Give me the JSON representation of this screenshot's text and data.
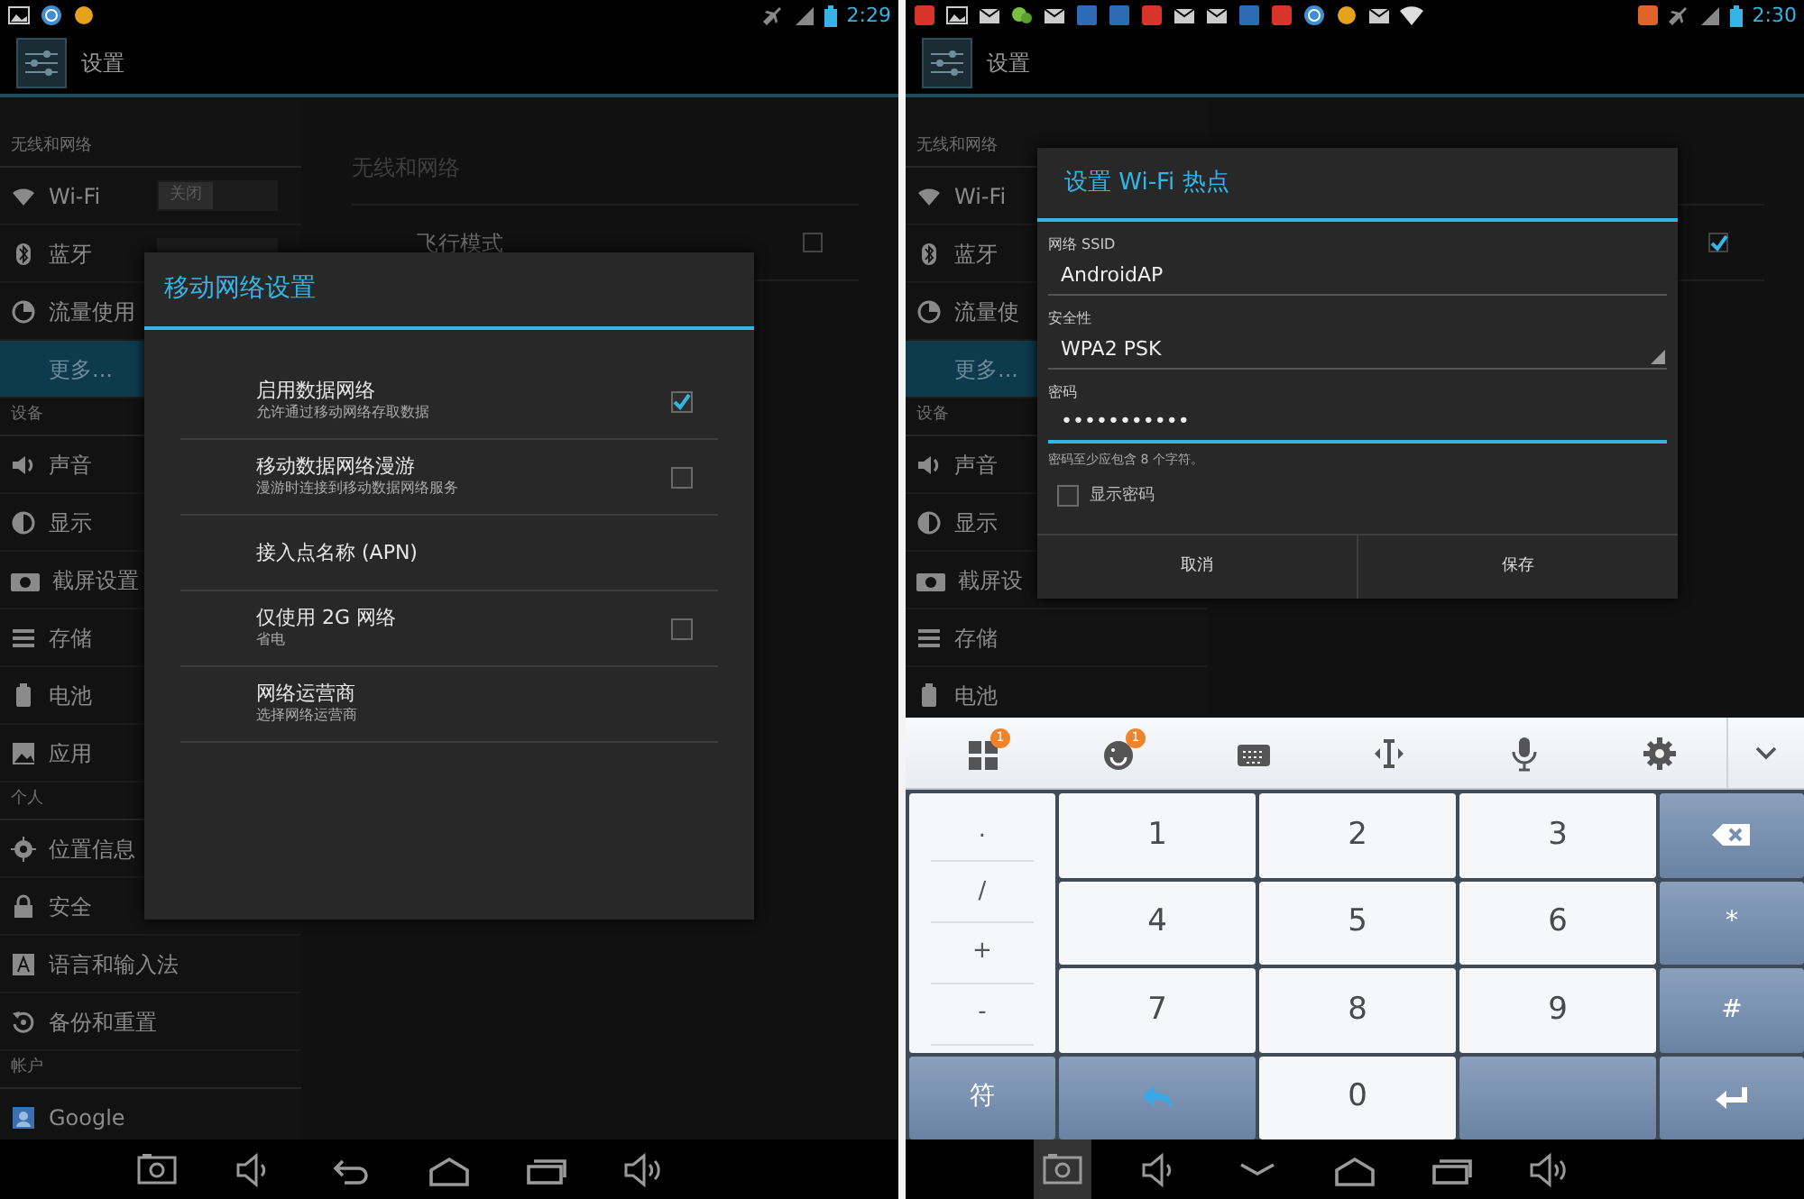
{
  "screens": [
    {
      "status_bar": {
        "time": "2:29"
      },
      "app_title": "设置",
      "sidebar": [
        {
          "kind": "header",
          "label": "无线和网络"
        },
        {
          "kind": "switch",
          "label": "Wi-Fi",
          "switch_text": "关闭",
          "selected": false
        },
        {
          "kind": "switch",
          "label": "蓝牙",
          "selected": false
        },
        {
          "kind": "item",
          "label": "流量使用",
          "selected": false
        },
        {
          "kind": "item",
          "label": "更多...",
          "selected": true
        },
        {
          "kind": "header",
          "label": "设备"
        },
        {
          "kind": "item",
          "label": "声音",
          "selected": false
        },
        {
          "kind": "item",
          "label": "显示",
          "selected": false
        },
        {
          "kind": "item",
          "label": "截屏设置",
          "selected": false
        },
        {
          "kind": "item",
          "label": "存储",
          "selected": false
        },
        {
          "kind": "item",
          "label": "电池",
          "selected": false
        },
        {
          "kind": "item",
          "label": "应用",
          "selected": false
        },
        {
          "kind": "header",
          "label": "个人"
        },
        {
          "kind": "item",
          "label": "位置信息",
          "selected": false
        },
        {
          "kind": "item",
          "label": "安全",
          "selected": false
        },
        {
          "kind": "item",
          "label": "语言和输入法",
          "selected": false
        },
        {
          "kind": "item",
          "label": "备份和重置",
          "selected": false
        },
        {
          "kind": "header",
          "label": "帐户"
        },
        {
          "kind": "item",
          "label": "Google",
          "selected": false
        }
      ],
      "content": {
        "header": "无线和网络",
        "rows": [
          {
            "label": "飞行模式",
            "checked": false
          }
        ]
      },
      "dialog": {
        "kind": "list",
        "title": "移动网络设置",
        "items": [
          {
            "kind": "check",
            "title": "启用数据网络",
            "summary": "允许通过移动网络存取数据",
            "checked": true
          },
          {
            "kind": "check",
            "title": "移动数据网络漫游",
            "summary": "漫游时连接到移动数据网络服务",
            "checked": false
          },
          {
            "kind": "plain",
            "title": "接入点名称 (APN)"
          },
          {
            "kind": "check",
            "title": "仅使用 2G 网络",
            "summary": "省电",
            "checked": false
          },
          {
            "kind": "plain",
            "title": "网络运营商",
            "summary": "选择网络运营商"
          }
        ]
      },
      "nav_bar": {
        "keyboard_open": false,
        "screenshot_pressed": false
      }
    },
    {
      "status_bar": {
        "time": "2:30"
      },
      "app_title": "设置",
      "sidebar": [
        {
          "kind": "header",
          "label": "无线和网络"
        },
        {
          "kind": "item",
          "label": "Wi-Fi",
          "selected": false
        },
        {
          "kind": "item",
          "label": "蓝牙",
          "selected": false
        },
        {
          "kind": "item",
          "label": "流量使",
          "selected": false
        },
        {
          "kind": "item",
          "label": "更多...",
          "selected": true
        },
        {
          "kind": "header",
          "label": "设备"
        },
        {
          "kind": "item",
          "label": "声音",
          "selected": false
        },
        {
          "kind": "item",
          "label": "显示",
          "selected": false
        },
        {
          "kind": "item",
          "label": "截屏设",
          "selected": false
        },
        {
          "kind": "item",
          "label": "存储",
          "selected": false
        },
        {
          "kind": "item",
          "label": "电池",
          "selected": false
        }
      ],
      "content": {
        "rows": [
          {
            "checked": true
          }
        ]
      },
      "dialog": {
        "kind": "form",
        "title": "设置 Wi-Fi 热点",
        "fields": [
          {
            "kind": "text",
            "label": "网络 SSID",
            "value": "AndroidAP",
            "focused": false
          },
          {
            "kind": "select",
            "label": "安全性",
            "value": "WPA2 PSK",
            "focused": false
          },
          {
            "kind": "password",
            "label": "密码",
            "value": "•••••••••••",
            "focused": true,
            "hint": "密码至少应包含 8 个字符。"
          }
        ],
        "show_password": {
          "label": "显示密码",
          "checked": false
        },
        "buttons": [
          "取消",
          "保存"
        ]
      },
      "keyboard": {
        "toolbar_badges": [
          "1",
          "1"
        ],
        "symbols": [
          ".",
          "/",
          "+",
          "-"
        ],
        "keys": [
          "1",
          "2",
          "3",
          "4",
          "5",
          "6",
          "7",
          "8",
          "9"
        ],
        "side_keys": [
          "*",
          "#"
        ],
        "bottom_row": [
          {
            "kind": "label",
            "label": "符",
            "light": false
          },
          {
            "kind": "undo",
            "light": false
          },
          {
            "kind": "label",
            "label": "0",
            "light": true
          },
          {
            "kind": "space",
            "light": false
          },
          {
            "kind": "enter",
            "light": false
          }
        ]
      },
      "nav_bar": {
        "keyboard_open": true,
        "screenshot_pressed": true
      }
    }
  ]
}
